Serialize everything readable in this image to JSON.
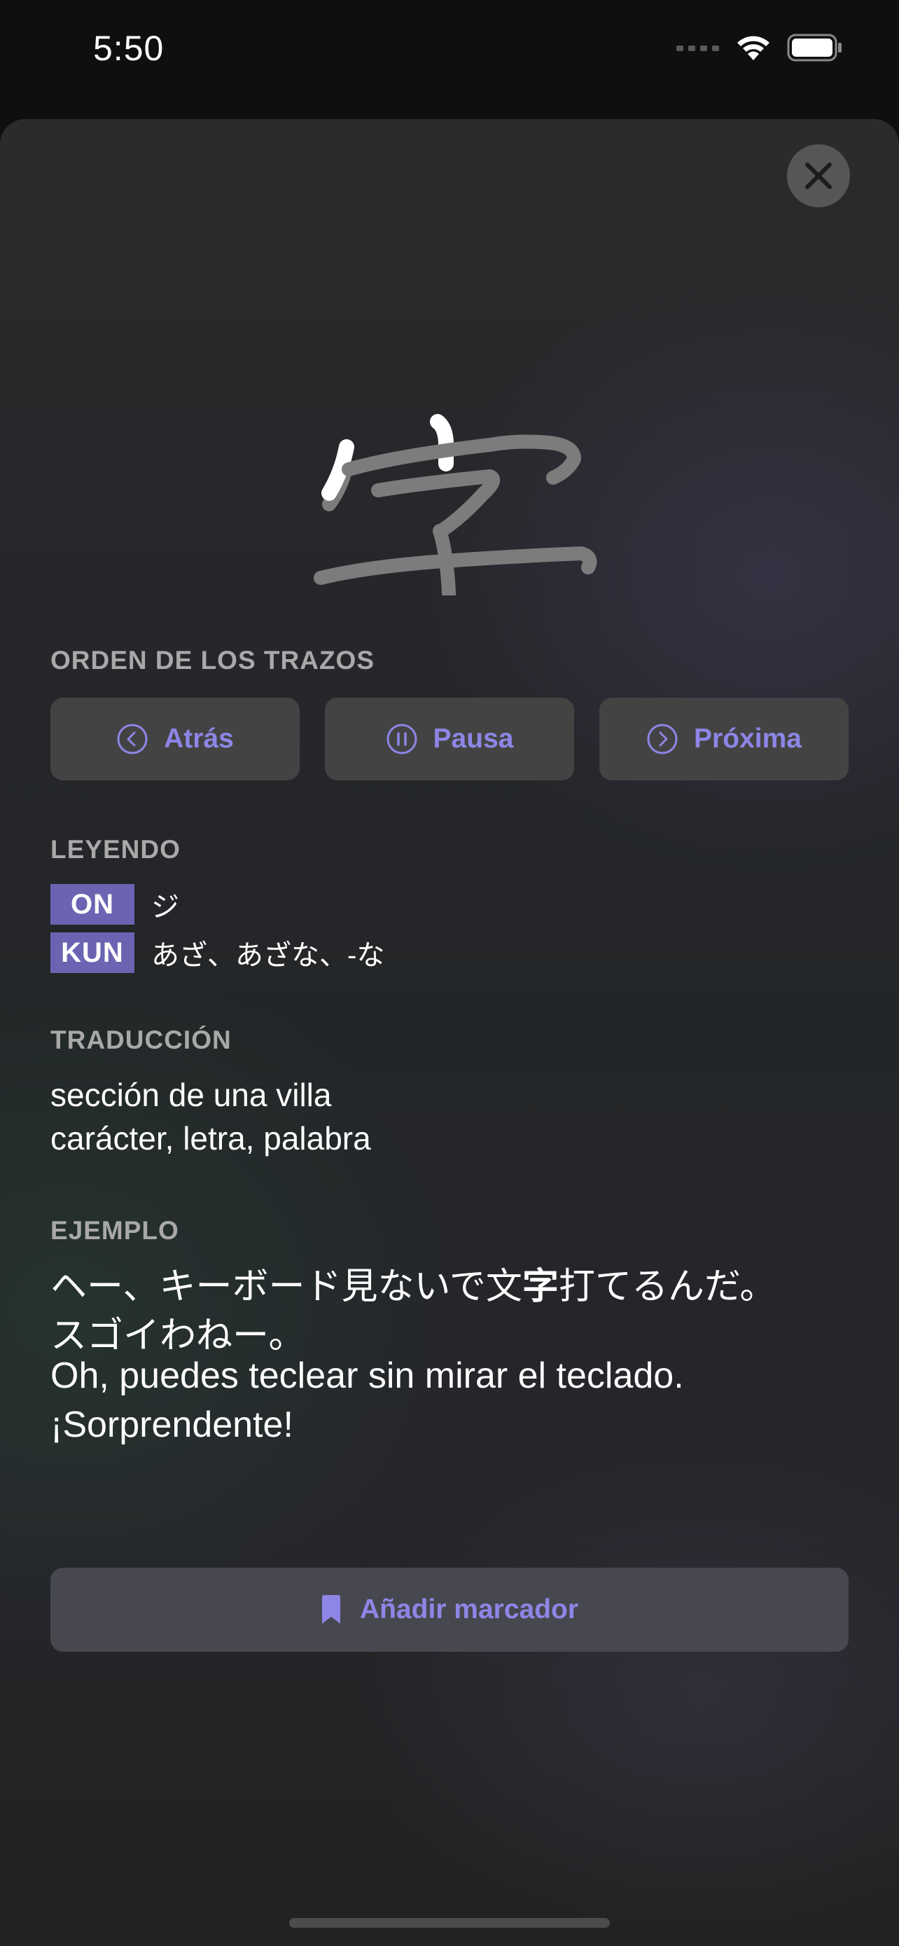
{
  "status_bar": {
    "time": "5:50",
    "icons": [
      "signal-icon",
      "wifi-icon",
      "battery-icon"
    ]
  },
  "kanji": {
    "character": "字",
    "stroke_color": "#7c7c7c",
    "highlight_color": "#ffffff"
  },
  "stroke_order": {
    "label": "ORDEN DE LOS TRAZOS",
    "back_label": "Atrás",
    "pause_label": "Pausa",
    "next_label": "Próxima"
  },
  "reading": {
    "label": "LEYENDO",
    "on_badge": "ON",
    "on_value": "ジ",
    "kun_badge": "KUN",
    "kun_value": "あざ、あざな、-な"
  },
  "translation": {
    "label": "TRADUCCIÓN",
    "lines": [
      "sección de una villa",
      "carácter, letra, palabra"
    ]
  },
  "example": {
    "label": "EJEMPLO",
    "jp_line1_before": "ヘー、キーボード見ないで文",
    "jp_line1_highlight": "字",
    "jp_line1_after": "打てるんだ。",
    "jp_line2": "スゴイわねー。",
    "es_line1": "Oh, puedes teclear sin mirar el teclado.",
    "es_line2": "¡Sorprendente!"
  },
  "bookmark": {
    "label": "Añadir marcador"
  },
  "colors": {
    "accent": "#8d86e6",
    "badge": "#6a64b2",
    "button_bg": "#434343"
  }
}
